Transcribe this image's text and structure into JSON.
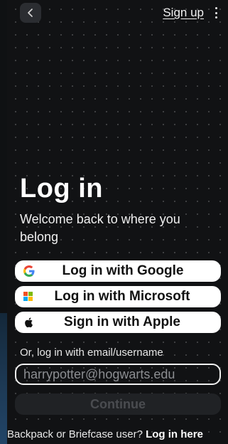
{
  "top_bar": {
    "back_icon": "chevron-left-icon",
    "signup_label": "Sign up",
    "more_icon": "vertical-ellipsis-icon"
  },
  "main": {
    "title": "Log in",
    "subtitle": "Welcome back to where you belong"
  },
  "sso": {
    "google_label": "Log in with Google",
    "microsoft_label": "Log in with Microsoft",
    "apple_label": "Sign in with Apple",
    "google_icon": "google-icon",
    "microsoft_icon": "microsoft-icon",
    "apple_icon": "apple-icon"
  },
  "email_login": {
    "label": "Or, log in with email/username",
    "placeholder": "harrypotter@hogwarts.edu",
    "continue_label": "Continue"
  },
  "footer": {
    "prompt": "Backpack or Briefcase user? ",
    "link_label": "Log in here"
  },
  "colors": {
    "background": "#111214",
    "button_bg": "#ffffff",
    "continue_disabled_bg": "#202225",
    "continue_disabled_text": "#4a4c50",
    "google_red": "#EA4335",
    "google_blue": "#4285F4",
    "google_yellow": "#FBBC05",
    "google_green": "#34A853",
    "ms_red": "#F25022",
    "ms_green": "#7FBA00",
    "ms_blue": "#00A4EF",
    "ms_yellow": "#FFB900"
  }
}
